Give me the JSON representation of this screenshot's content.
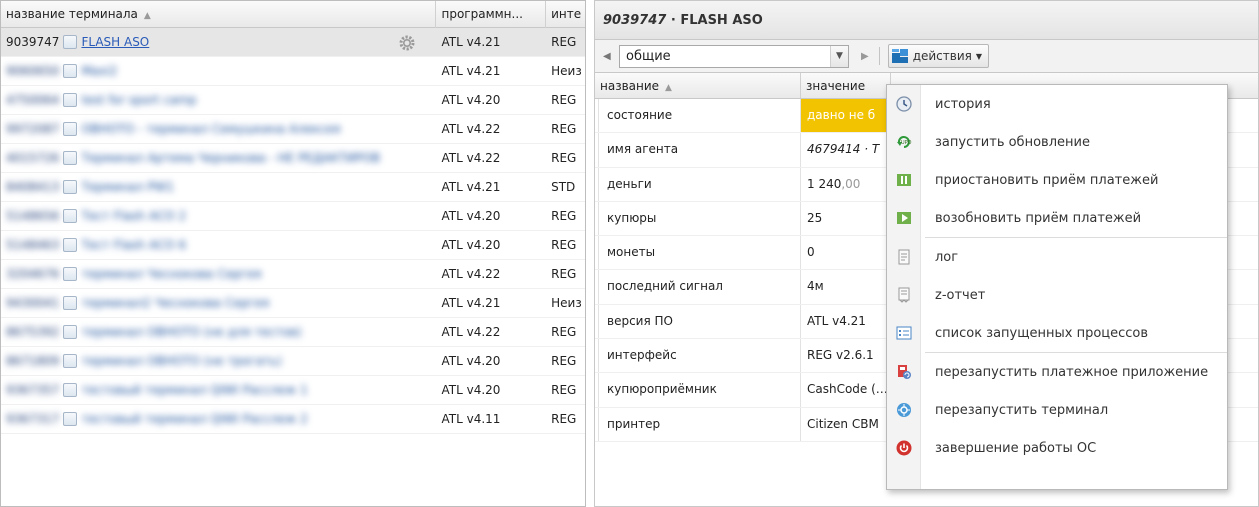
{
  "left_grid": {
    "columns": [
      "название терминала",
      "программн...",
      "инте"
    ],
    "rows": [
      {
        "id": "9039747",
        "name": "FLASH ASO",
        "software": "ATL v4.21",
        "interface": "REG",
        "selected": true
      },
      {
        "id": "9060650",
        "name": "Maxi2",
        "software": "ATL v4.21",
        "interface": "Неиз"
      },
      {
        "id": "4750064",
        "name": "test for sport camp",
        "software": "ATL v4.20",
        "interface": "REG"
      },
      {
        "id": "9972087",
        "name": "OBHOTO - терминал Семушкина Алексея",
        "software": "ATL v4.22",
        "interface": "REG"
      },
      {
        "id": "4015726",
        "name": "Терминал Артема Черникова - НЕ РЕДАКТИРОВ",
        "software": "ATL v4.22",
        "interface": "REG"
      },
      {
        "id": "8408413",
        "name": "Терминал PW1",
        "software": "ATL v4.21",
        "interface": "STD"
      },
      {
        "id": "5148656",
        "name": "Тест Flash ACO 2",
        "software": "ATL v4.20",
        "interface": "REG"
      },
      {
        "id": "5148463",
        "name": "Тест Flash ACO 6",
        "software": "ATL v4.20",
        "interface": "REG"
      },
      {
        "id": "3204676",
        "name": "терминал Чеснокова Сергея",
        "software": "ATL v4.22",
        "interface": "REG"
      },
      {
        "id": "9430041",
        "name": "терминал2 Чеснокова Сергея",
        "software": "ATL v4.21",
        "interface": "Неиз"
      },
      {
        "id": "8675392",
        "name": "терминал OBHOTO (не для тестов)",
        "software": "ATL v4.22",
        "interface": "REG"
      },
      {
        "id": "8671809",
        "name": "терминал OBHOTO (не трогать)",
        "software": "ATL v4.20",
        "interface": "REG"
      },
      {
        "id": "9367357",
        "name": "тестовый терминал QIWI Расcлеж 1",
        "software": "ATL v4.20",
        "interface": "REG"
      },
      {
        "id": "9367317",
        "name": "тестовый терминал QIWI Расcлеж 2",
        "software": "ATL v4.11",
        "interface": "REG"
      }
    ]
  },
  "right_panel": {
    "title_id": "9039747",
    "title_sep": "·",
    "title_name": "FLASH ASO",
    "group_value": "общие",
    "actions_label": "действия",
    "columns": [
      "название",
      "значение"
    ],
    "rows": [
      {
        "name": "состояние",
        "value": "давно не б",
        "style": "warn"
      },
      {
        "name": "имя агента",
        "value": "4679414 · Т",
        "style": "it"
      },
      {
        "name": "деньги",
        "value": "1 240",
        "suffix": ",00"
      },
      {
        "name": "купюры",
        "value": "25"
      },
      {
        "name": "монеты",
        "value": "0"
      },
      {
        "name": "последний сигнал",
        "value": "4м"
      },
      {
        "name": "версия ПО",
        "value": "ATL v4.21"
      },
      {
        "name": "интерфейс",
        "value": "REG v2.6.1"
      },
      {
        "name": "купюроприёмник",
        "value": "CashCode (…"
      },
      {
        "name": "принтер",
        "value": "Citizen CBM"
      }
    ]
  },
  "actions_menu": {
    "items": [
      {
        "label": "история",
        "icon": "history-icon"
      },
      {
        "label": "запустить обновление",
        "icon": "update-icon"
      },
      {
        "label": "приостановить приём платежей",
        "icon": "pause-payments-icon"
      },
      {
        "label": "возобновить приём платежей",
        "icon": "resume-payments-icon"
      },
      {
        "label": "лог",
        "icon": "log-icon",
        "separator_before": true
      },
      {
        "label": "z-отчет",
        "icon": "z-report-icon"
      },
      {
        "label": "список запущенных процессов",
        "icon": "process-list-icon"
      },
      {
        "label": "перезапустить платежное приложение",
        "icon": "restart-app-icon",
        "separator_before": true
      },
      {
        "label": "перезапустить терминал",
        "icon": "restart-terminal-icon"
      },
      {
        "label": "завершение работы ОС",
        "icon": "power-icon"
      }
    ]
  }
}
